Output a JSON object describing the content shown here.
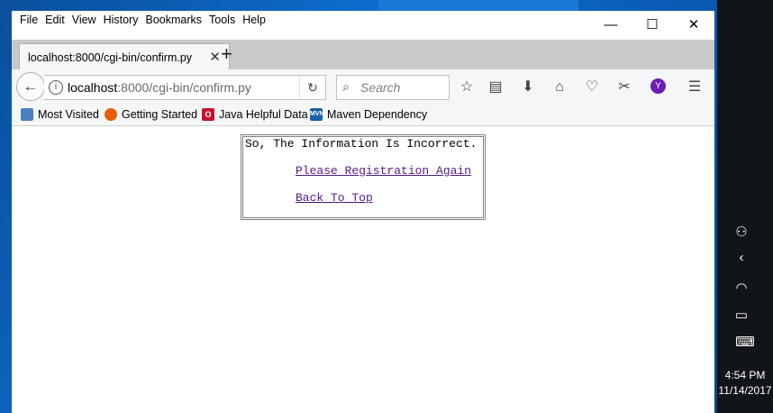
{
  "menu": [
    "File",
    "Edit",
    "View",
    "History",
    "Bookmarks",
    "Tools",
    "Help"
  ],
  "tab": {
    "title": "localhost:8000/cgi-bin/confirm.py"
  },
  "url": {
    "host": "localhost",
    "path": ":8000/cgi-bin/confirm.py"
  },
  "search": {
    "placeholder": "Search"
  },
  "avatar_letter": "Y",
  "bookmarks": [
    "Most Visited",
    "Getting Started",
    "Java Helpful Data",
    "Maven Dependency"
  ],
  "page": {
    "message": "So, The Information Is Incorrect.",
    "link_register": "Please Registration Again",
    "link_top": "Back To Top"
  },
  "clock": {
    "time": "4:54 PM",
    "date": "11/14/2017"
  },
  "colors": {
    "link_visited": "#551a8b",
    "tabstrip": "#c9c9c9",
    "taskbar": "#111418"
  }
}
